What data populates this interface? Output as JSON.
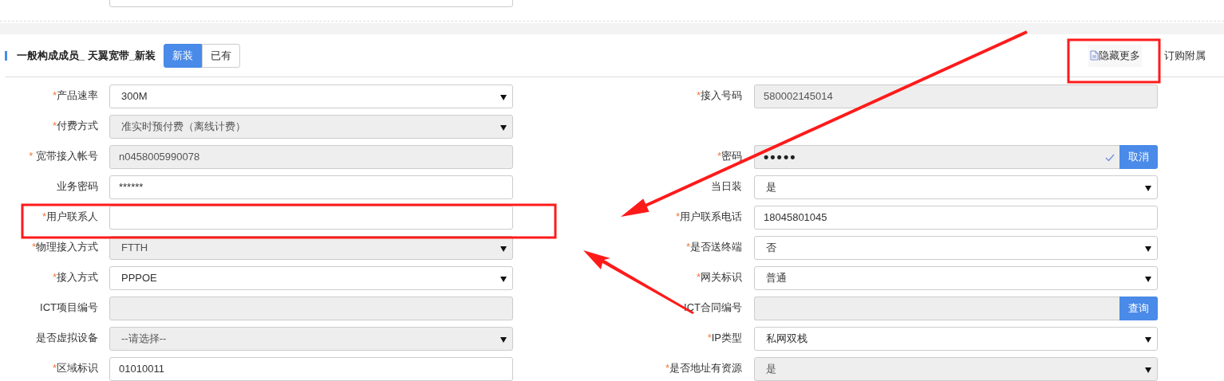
{
  "section": {
    "title": "一般构成成员_ 天翼宽带_新装",
    "modes": [
      {
        "label": "新装",
        "selected": true
      },
      {
        "label": "已有",
        "selected": false
      }
    ],
    "actions": [
      {
        "kind": "toggle",
        "label": "隐藏更多"
      },
      {
        "kind": "link",
        "label": "订购附属"
      }
    ]
  },
  "rows": [
    {
      "left": {
        "mark": "*",
        "label": "产品速率",
        "kind": "select",
        "value": "300M",
        "disabled": false
      },
      "right": {
        "mark": "*",
        "label": "接入号码",
        "kind": "input",
        "value": "580002145014",
        "disabled": true
      }
    },
    {
      "left": {
        "mark": "*",
        "label": "付费方式",
        "kind": "select",
        "value": "准实时预付费（离线计费）",
        "disabled": true
      },
      "right": null
    },
    {
      "left": {
        "mark": "*",
        "label": " 宽带接入帐号",
        "kind": "input",
        "value": "n0458005990078",
        "disabled": true
      },
      "right": {
        "mark": "*",
        "label": "密码",
        "kind": "password",
        "value": "•••••",
        "disabled": true,
        "button": "取消"
      }
    },
    {
      "left": {
        "label": "业务密码",
        "kind": "input",
        "value": "******",
        "disabled": false
      },
      "right": {
        "label": "当日装",
        "kind": "select",
        "value": "是",
        "disabled": false
      }
    },
    {
      "left": {
        "mark": "*",
        "label": "用户联系人",
        "kind": "input",
        "disabled": false
      },
      "right": {
        "mark": "*",
        "label": "用户联系电话",
        "kind": "input",
        "value": "18045801045",
        "disabled": false
      }
    },
    {
      "left": {
        "mark": "*",
        "label": "物理接入方式",
        "kind": "select",
        "value": "FTTH",
        "disabled": true
      },
      "right": {
        "mark": "*",
        "label": "是否送终端",
        "kind": "select",
        "value": "否",
        "disabled": false
      }
    },
    {
      "left": {
        "mark": "*",
        "label": "接入方式",
        "kind": "select",
        "value": "PPPOE",
        "disabled": false
      },
      "right": {
        "mark": "*",
        "label": "网关标识",
        "kind": "select",
        "value": "普通",
        "disabled": false
      }
    },
    {
      "left": {
        "label": "ICT项目编号",
        "kind": "input",
        "disabled": true
      },
      "right": {
        "label": "ICT合同编号",
        "kind": "search",
        "disabled": true,
        "button": "查询"
      }
    },
    {
      "left": {
        "label": "是否虚拟设备",
        "kind": "select",
        "value": "--请选择--",
        "disabled": true
      },
      "right": {
        "mark": "*",
        "label": "IP类型",
        "kind": "select",
        "value": "私网双栈",
        "disabled": false
      }
    },
    {
      "left": {
        "mark": "*",
        "label": "区域标识",
        "kind": "input",
        "value": "01010011",
        "disabled": false
      },
      "right": {
        "mark": "*",
        "label": "是否地址有资源",
        "kind": "select",
        "value": "是",
        "disabled": true
      }
    }
  ]
}
